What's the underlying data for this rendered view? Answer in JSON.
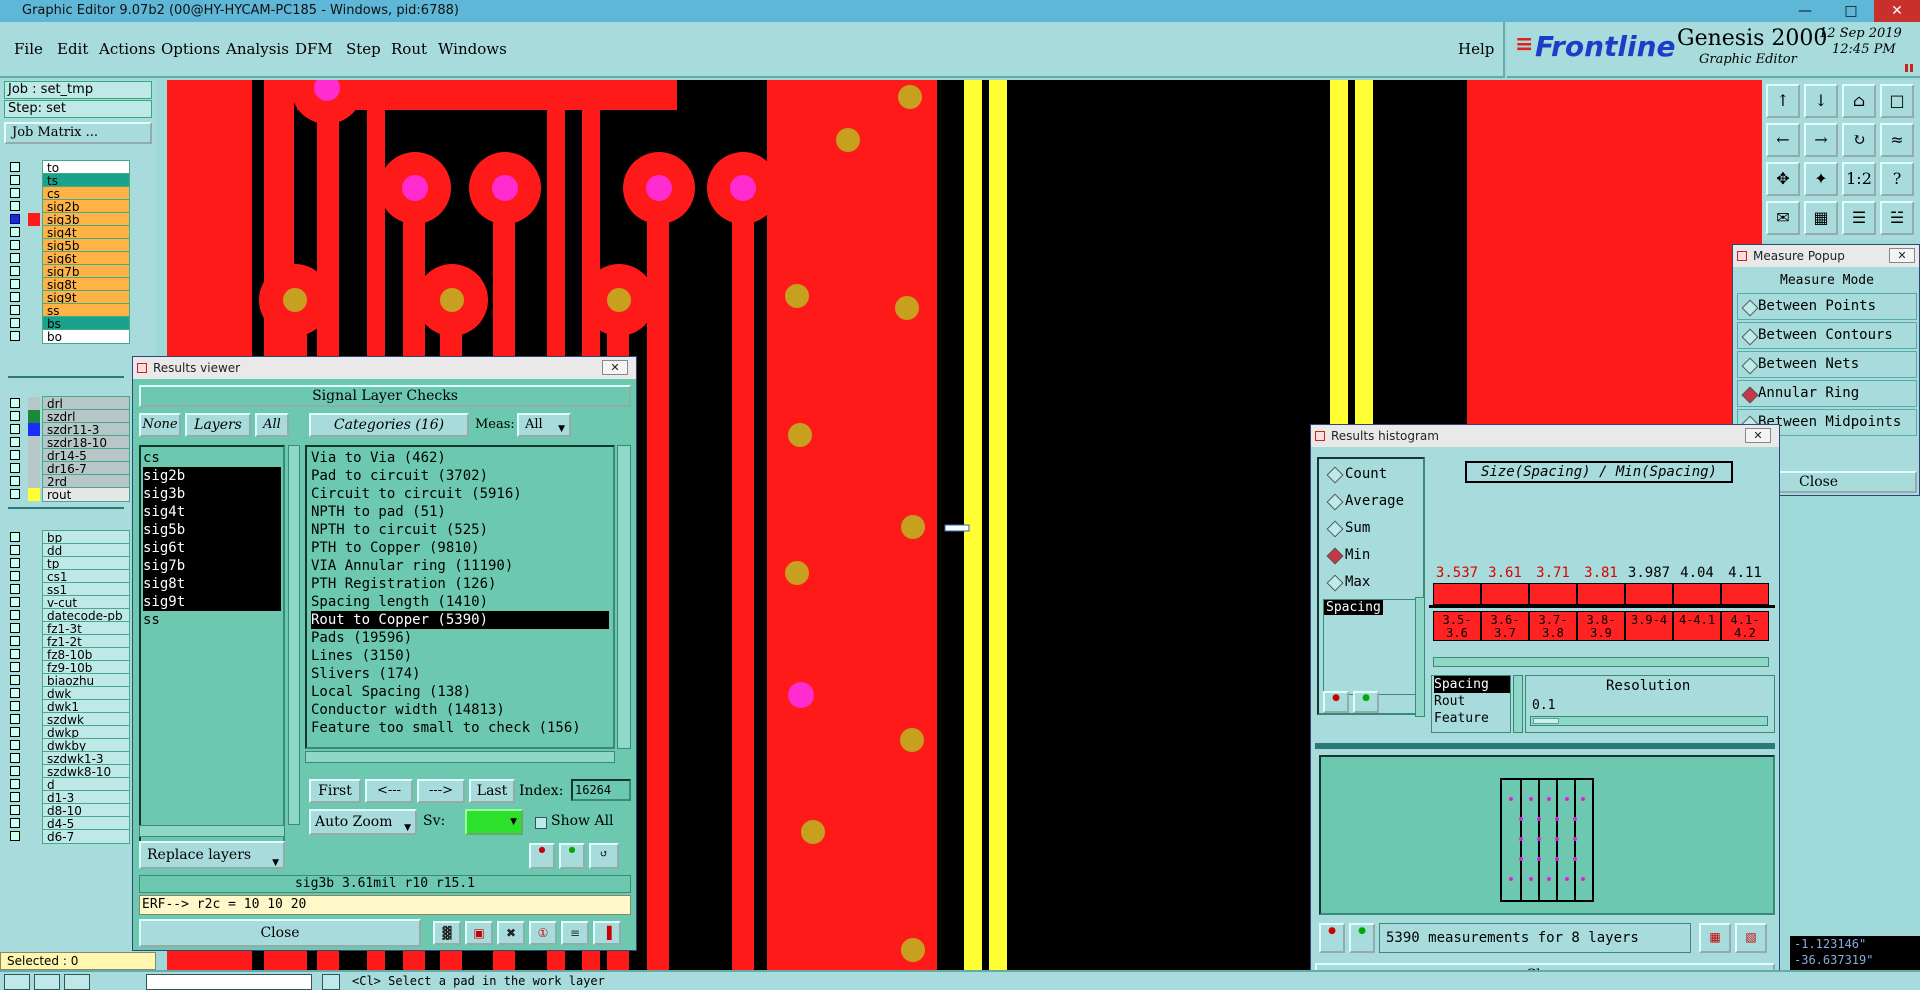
{
  "window": {
    "title": "Graphic Editor 9.07b2 (00@HY-HYCAM-PC185 - Windows, pid:6788)"
  },
  "menu": {
    "items": [
      "File",
      "Edit",
      "Actions",
      "Options",
      "Analysis",
      "DFM",
      "Step",
      "Rout",
      "Windows"
    ],
    "help": "Help"
  },
  "brand": {
    "logo": "Frontline",
    "product": "Genesis 2000",
    "subtitle": "Graphic Editor",
    "date": "12 Sep 2019",
    "time": "12:45 PM"
  },
  "job": {
    "job_label": "Job : set_tmp",
    "step_label": "Step: set",
    "matrix_button": "Job Matrix ..."
  },
  "layers": {
    "group1": [
      {
        "name": "to",
        "color": "#ffffff"
      },
      {
        "name": "ts",
        "color": "#1aa38a"
      },
      {
        "name": "cs",
        "color": "#ffb347"
      },
      {
        "name": "sig2b",
        "color": "#ffb347"
      },
      {
        "name": "sig3b",
        "color": "#ffb347"
      },
      {
        "name": "sig4t",
        "color": "#ffb347"
      },
      {
        "name": "sig5b",
        "color": "#ffb347"
      },
      {
        "name": "sig6t",
        "color": "#ffb347"
      },
      {
        "name": "sig7b",
        "color": "#ffb347"
      },
      {
        "name": "sig8t",
        "color": "#ffb347"
      },
      {
        "name": "sig9t",
        "color": "#ffb347"
      },
      {
        "name": "ss",
        "color": "#ffb347"
      },
      {
        "name": "bs",
        "color": "#1aa38a"
      },
      {
        "name": "bo",
        "color": "#ffffff"
      }
    ],
    "group2": [
      {
        "name": "drl",
        "color": "#b7c7c7"
      },
      {
        "name": "szdrl",
        "color": "#b7c7c7"
      },
      {
        "name": "szdr11-3",
        "color": "#b7c7c7"
      },
      {
        "name": "szdr18-10",
        "color": "#b7c7c7"
      },
      {
        "name": "dr14-5",
        "color": "#b7c7c7"
      },
      {
        "name": "dr16-7",
        "color": "#b7c7c7"
      },
      {
        "name": "2rd",
        "color": "#b7c7c7"
      },
      {
        "name": "rout",
        "color": "#e6e6e6"
      }
    ],
    "group3": [
      "bp",
      "dd",
      "tp",
      "cs1",
      "ss1",
      "v-cut",
      "datecode-pb",
      "fz1-3t",
      "fz1-2t",
      "fz8-10b",
      "fz9-10b",
      "biaozhu",
      "dwk",
      "dwk1",
      "szdwk",
      "dwkp",
      "dwkby",
      "szdwk1-3",
      "szdwk8-10",
      "d",
      "d1-3",
      "d8-10",
      "d4-5",
      "d6-7"
    ],
    "selected": "Selected : 0"
  },
  "results_viewer": {
    "title": "Results viewer",
    "header": "Signal Layer Checks",
    "none_btn": "None",
    "layers_btn": "Layers",
    "all_btn": "All",
    "categories_btn": "Categories (16)",
    "meas_label": "Meas:",
    "meas_value": "All",
    "layer_list": [
      "cs",
      "sig2b",
      "sig3b",
      "sig4t",
      "sig5b",
      "sig6t",
      "sig7b",
      "sig8t",
      "sig9t",
      "ss"
    ],
    "categories": [
      "Via to Via (462)",
      "Pad to circuit (3702)",
      "Circuit to circuit (5916)",
      "NPTH to pad (51)",
      "NPTH to circuit (525)",
      "PTH to Copper (9810)",
      "VIA Annular ring (11190)",
      "PTH Registration (126)",
      "Spacing length (1410)",
      "Rout to Copper (5390)",
      "Pads (19596)",
      "Lines (3150)",
      "Slivers (174)",
      "Local Spacing (138)",
      "Conductor width (14813)",
      "Feature too small to check (156)"
    ],
    "first": "First",
    "prev": "<---",
    "next": "--->",
    "last": "Last",
    "index_label": "Index:",
    "index_value": "16264",
    "autozoom": "Auto Zoom",
    "sv_label": "Sv:",
    "show_all": "Show All",
    "replace_layers": "Replace layers",
    "status": "sig3b 3.61mil   r10   r15.1",
    "erf": "ERF--> r2c = 10 10 20",
    "close": "Close"
  },
  "measure_popup": {
    "title": "Measure Popup",
    "mode_label": "Measure Mode",
    "modes": [
      "Between Points",
      "Between Contours",
      "Between Nets",
      "Annular Ring",
      "Between Midpoints"
    ],
    "close": "Close"
  },
  "histogram": {
    "title": "Results histogram",
    "modes": [
      "Count",
      "Average",
      "Sum",
      "Min",
      "Max"
    ],
    "heading": "Size(Spacing) / Min(Spacing)",
    "list_item": "Spacing",
    "bars": [
      {
        "value": "3.537",
        "range": "3.5-3.6"
      },
      {
        "value": "3.61",
        "range": "3.6-3.7"
      },
      {
        "value": "3.71",
        "range": "3.7-3.8"
      },
      {
        "value": "3.81",
        "range": "3.8-3.9"
      },
      {
        "value": "3.987",
        "range": "3.9-4"
      },
      {
        "value": "4.04",
        "range": "4-4.1"
      },
      {
        "value": "4.11",
        "range": "4.1-4.2"
      }
    ],
    "types": [
      "Spacing",
      "Rout",
      "Feature"
    ],
    "resolution_label": "Resolution",
    "resolution_value": "0.1",
    "summary": "5390 measurements for 8 layers",
    "close": "Close"
  },
  "coords": {
    "x": "-1.123146\"",
    "y": "-36.637319\""
  },
  "bottom": {
    "prompt": "<Cl>  Select a pad in the work layer"
  },
  "colors": {
    "panel": "#a8dcdc",
    "dialog": "#6cc9b0",
    "copper": "#ff1a1a",
    "pad": "#ff2dd0",
    "drill": "#c8a020",
    "rout": "#ffff33"
  }
}
